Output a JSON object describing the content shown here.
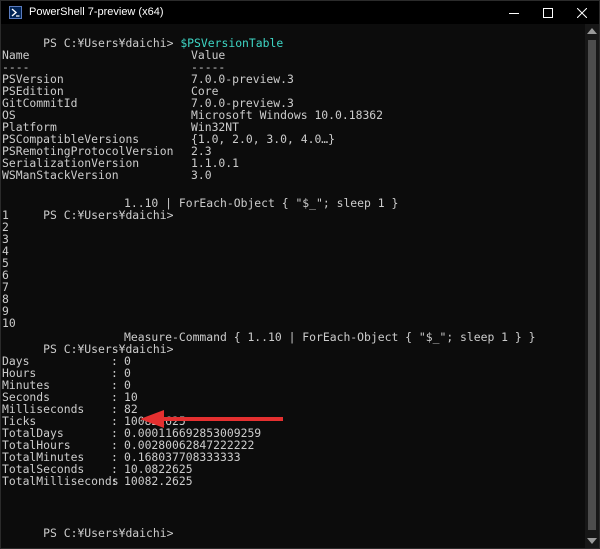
{
  "window": {
    "title": "PowerShell 7-preview (x64)",
    "icons": [
      "powershell-icon",
      "minimize-icon",
      "maximize-icon",
      "close-icon"
    ]
  },
  "console": {
    "prompt": "PS C:¥Users¥daichi>",
    "commands": {
      "c1": "$PSVersionTable",
      "c2": "1..10 | ForEach-Object { \"$_\"; sleep 1 }",
      "c3": "Measure-Command { 1..10 | ForEach-Object { \"$_\"; sleep 1 } }"
    },
    "version_table": {
      "headers": [
        "Name",
        "Value"
      ],
      "underlines": [
        "----",
        "-----"
      ],
      "rows": [
        [
          "PSVersion",
          "7.0.0-preview.3"
        ],
        [
          "PSEdition",
          "Core"
        ],
        [
          "GitCommitId",
          "7.0.0-preview.3"
        ],
        [
          "OS",
          "Microsoft Windows 10.0.18362"
        ],
        [
          "Platform",
          "Win32NT"
        ],
        [
          "PSCompatibleVersions",
          "{1.0, 2.0, 3.0, 4.0…}"
        ],
        [
          "PSRemotingProtocolVersion",
          "2.3"
        ],
        [
          "SerializationVersion",
          "1.1.0.1"
        ],
        [
          "WSManStackVersion",
          "3.0"
        ]
      ]
    },
    "numbers": [
      "1",
      "2",
      "3",
      "4",
      "5",
      "6",
      "7",
      "8",
      "9",
      "10"
    ],
    "measure": {
      "separator": ":",
      "rows": [
        [
          "Days",
          "0"
        ],
        [
          "Hours",
          "0"
        ],
        [
          "Minutes",
          "0"
        ],
        [
          "Seconds",
          "10"
        ],
        [
          "Milliseconds",
          "82"
        ],
        [
          "Ticks",
          "100822625"
        ],
        [
          "TotalDays",
          "0.000116692853009259"
        ],
        [
          "TotalHours",
          "0.00280062847222222"
        ],
        [
          "TotalMinutes",
          "0.168037708333333"
        ],
        [
          "TotalSeconds",
          "10.0822625"
        ],
        [
          "TotalMilliseconds",
          "10082.2625"
        ]
      ]
    }
  },
  "annotation": {
    "color": "#e53030",
    "icon": "red-arrow-icon"
  }
}
